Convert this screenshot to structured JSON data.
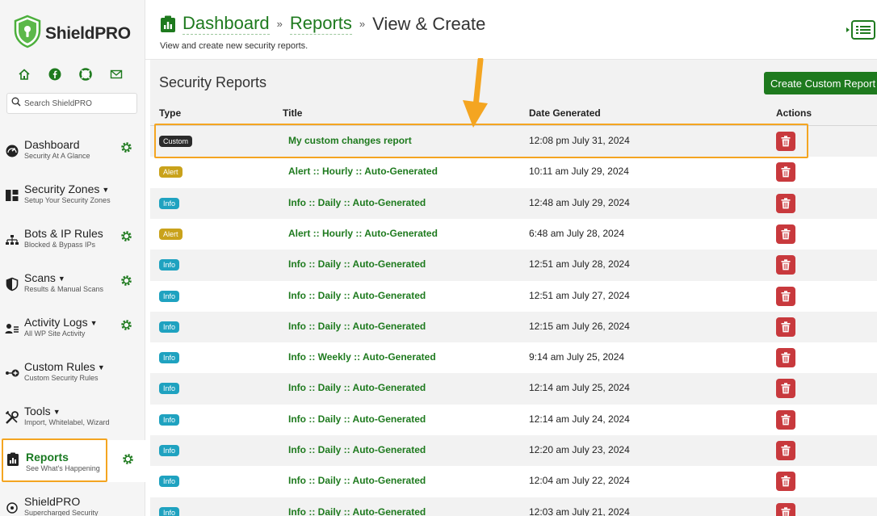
{
  "brand": {
    "name": "ShieldPRO"
  },
  "search": {
    "placeholder": "Search ShieldPRO"
  },
  "quick_links": [
    {
      "icon": "home-icon"
    },
    {
      "icon": "facebook-icon"
    },
    {
      "icon": "lifebuoy-icon"
    },
    {
      "icon": "envelope-icon"
    }
  ],
  "nav": [
    {
      "label": "Dashboard",
      "sub": "Security At A Glance",
      "caret": "",
      "icon": "dashboard-gauge-icon",
      "gear": true
    },
    {
      "label": "Security Zones",
      "sub": "Setup Your Security Zones",
      "caret": "▼",
      "icon": "zones-grid-icon",
      "gear": false
    },
    {
      "label": "Bots & IP Rules",
      "sub": "Blocked & Bypass IPs",
      "caret": "",
      "icon": "network-icon",
      "gear": true
    },
    {
      "label": "Scans",
      "sub": "Results & Manual Scans",
      "caret": "▼",
      "icon": "shield-half-icon",
      "gear": true
    },
    {
      "label": "Activity Logs",
      "sub": "All WP Site Activity",
      "caret": "▼",
      "icon": "user-list-icon",
      "gear": true
    },
    {
      "label": "Custom Rules",
      "sub": "Custom Security Rules",
      "caret": "▼",
      "icon": "custom-rules-icon",
      "gear": false
    },
    {
      "label": "Tools",
      "sub": "Import, Whitelabel, Wizard",
      "caret": "▼",
      "icon": "tools-icon",
      "gear": false
    },
    {
      "label": "Reports",
      "sub": "See What's Happening",
      "caret": "",
      "icon": "report-clipboard-icon",
      "gear": true,
      "active": true
    },
    {
      "label": "ShieldPRO",
      "sub": "Supercharged Security",
      "caret": "",
      "icon": "shield-pro-icon",
      "gear": false
    }
  ],
  "breadcrumb": {
    "items": [
      "Dashboard",
      "Reports"
    ],
    "separator": "»",
    "current": "View & Create"
  },
  "page": {
    "subtitle": "View and create new security reports."
  },
  "panel": {
    "title": "Security Reports",
    "create_button": "Create Custom Report"
  },
  "table": {
    "headers": [
      "Type",
      "Title",
      "Date Generated",
      "Actions"
    ],
    "rows": [
      {
        "type": "Custom",
        "title": "My custom changes report",
        "date": "12:08 pm July 31, 2024"
      },
      {
        "type": "Alert",
        "title": "Alert :: Hourly :: Auto-Generated",
        "date": "10:11 am July 29, 2024"
      },
      {
        "type": "Info",
        "title": "Info :: Daily :: Auto-Generated",
        "date": "12:48 am July 29, 2024"
      },
      {
        "type": "Alert",
        "title": "Alert :: Hourly :: Auto-Generated",
        "date": "6:48 am July 28, 2024"
      },
      {
        "type": "Info",
        "title": "Info :: Daily :: Auto-Generated",
        "date": "12:51 am July 28, 2024"
      },
      {
        "type": "Info",
        "title": "Info :: Daily :: Auto-Generated",
        "date": "12:51 am July 27, 2024"
      },
      {
        "type": "Info",
        "title": "Info :: Daily :: Auto-Generated",
        "date": "12:15 am July 26, 2024"
      },
      {
        "type": "Info",
        "title": "Info :: Weekly :: Auto-Generated",
        "date": "9:14 am July 25, 2024"
      },
      {
        "type": "Info",
        "title": "Info :: Daily :: Auto-Generated",
        "date": "12:14 am July 25, 2024"
      },
      {
        "type": "Info",
        "title": "Info :: Daily :: Auto-Generated",
        "date": "12:14 am July 24, 2024"
      },
      {
        "type": "Info",
        "title": "Info :: Daily :: Auto-Generated",
        "date": "12:20 am July 23, 2024"
      },
      {
        "type": "Info",
        "title": "Info :: Daily :: Auto-Generated",
        "date": "12:04 am July 22, 2024"
      },
      {
        "type": "Info",
        "title": "Info :: Daily :: Auto-Generated",
        "date": "12:03 am July 21, 2024"
      }
    ]
  },
  "colors": {
    "brand_green": "#1e7a1e",
    "highlight_orange": "#f4a521",
    "delete_red": "#c8393d",
    "badge_custom": "#2b2b2b",
    "badge_alert": "#c9a21b",
    "badge_info": "#1fa2c0"
  }
}
